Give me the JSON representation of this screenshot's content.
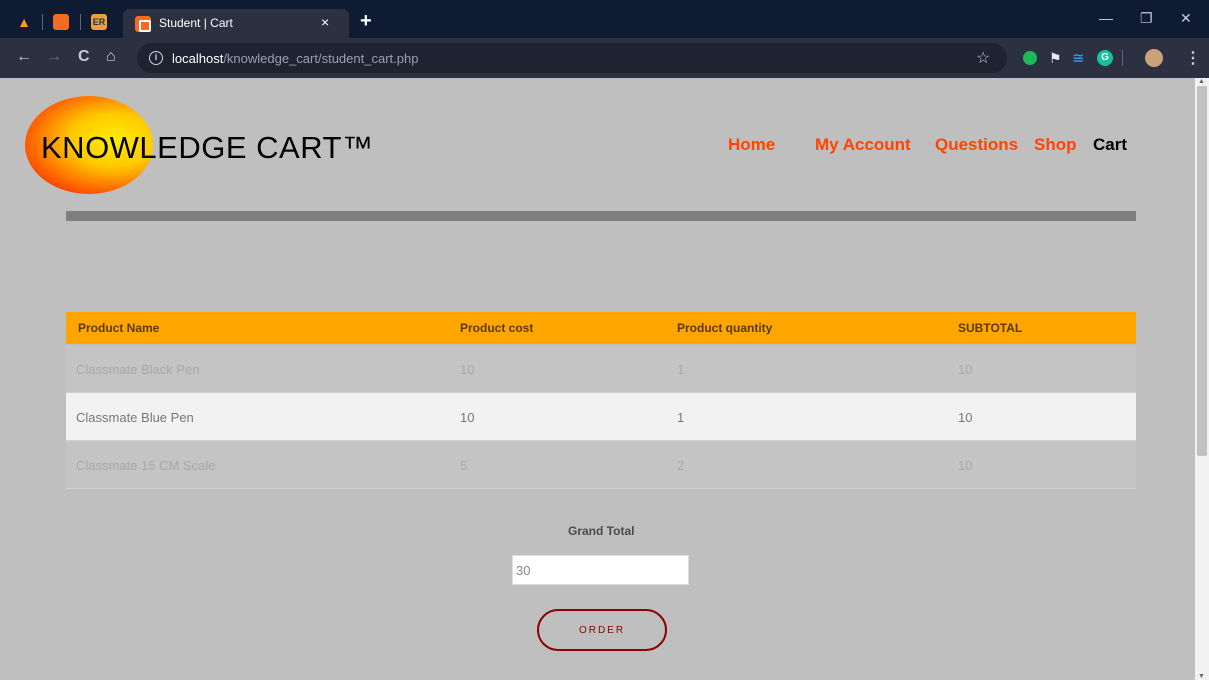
{
  "browser": {
    "pinned": [
      {
        "icon": "monitor-logo-icon",
        "label": ""
      },
      {
        "icon": "xampp-icon",
        "label": ""
      },
      {
        "icon": "er-icon",
        "label": "ER"
      }
    ],
    "tab": {
      "title": "Student | Cart",
      "close": "×"
    },
    "new_tab": "+",
    "window": {
      "minimize": "—",
      "restore": "❐",
      "close": "✕"
    },
    "nav": {
      "back": "←",
      "forward": "→",
      "reload": "C",
      "home": "⌂"
    },
    "url": {
      "host": "localhost",
      "path": "/knowledge_cart/student_cart.php"
    },
    "star": "☆",
    "extensions": [
      "green-dot-icon",
      "flag-icon",
      "lines-icon",
      "grammarly-icon",
      "avatar-icon"
    ]
  },
  "site": {
    "logo": "KNOWLEDGE CART™",
    "nav": [
      "Home",
      "My Account",
      "Questions",
      "Shop",
      "Cart"
    ],
    "active_nav": "Cart"
  },
  "table": {
    "headers": [
      "Product Name",
      "Product cost",
      "Product quantity",
      "SUBTOTAL"
    ],
    "rows": [
      [
        "Classmate Black Pen",
        "10",
        "1",
        "10"
      ],
      [
        "Classmate Blue Pen",
        "10",
        "1",
        "10"
      ],
      [
        "Classmate 15 CM Scale",
        "5",
        "2",
        "10"
      ]
    ]
  },
  "grand_total": {
    "label": "Grand Total",
    "value": "30"
  },
  "order_button": "ORDER",
  "colors": {
    "accent": "#ffa500",
    "nav": "#ff4500",
    "order": "#8b0000",
    "background": "#bfbfbf"
  }
}
